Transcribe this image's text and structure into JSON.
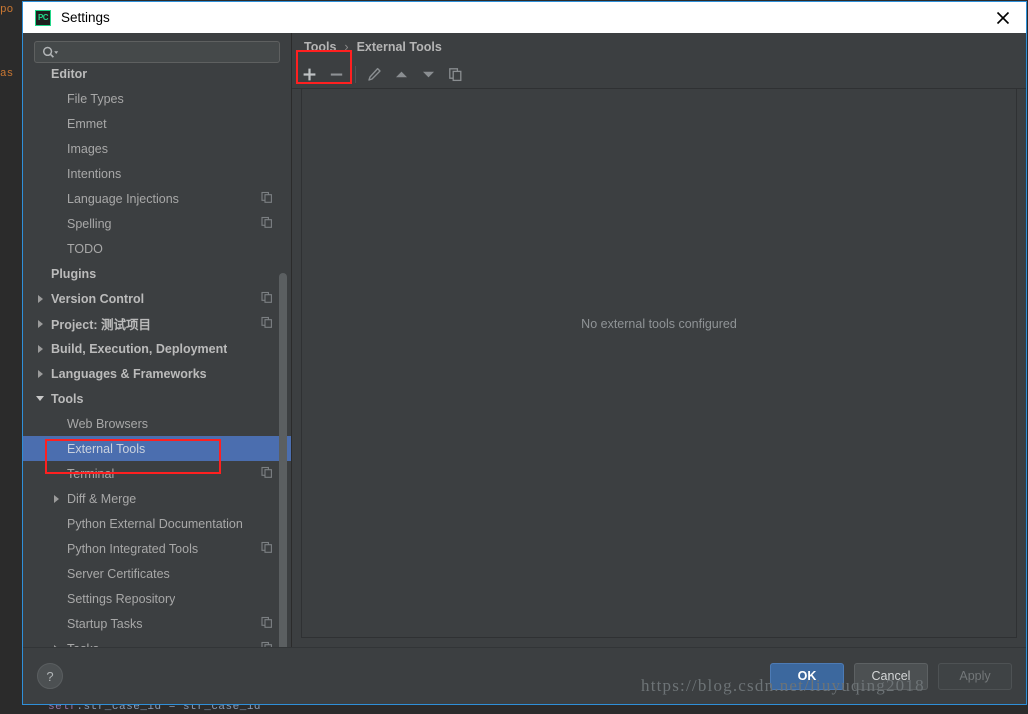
{
  "window": {
    "title": "Settings",
    "app_icon": "PC",
    "close_icon": "close-icon"
  },
  "sidebar": {
    "search": {
      "value": "",
      "placeholder": "",
      "icon": "search-icon"
    },
    "items": [
      {
        "label": "Editor",
        "level": 0,
        "bold": true,
        "arrow": "none",
        "copy": false,
        "selected": false
      },
      {
        "label": "File Types",
        "level": 1,
        "bold": false,
        "arrow": "none",
        "copy": false,
        "selected": false
      },
      {
        "label": "Emmet",
        "level": 1,
        "bold": false,
        "arrow": "none",
        "copy": false,
        "selected": false
      },
      {
        "label": "Images",
        "level": 1,
        "bold": false,
        "arrow": "none",
        "copy": false,
        "selected": false
      },
      {
        "label": "Intentions",
        "level": 1,
        "bold": false,
        "arrow": "none",
        "copy": false,
        "selected": false
      },
      {
        "label": "Language Injections",
        "level": 1,
        "bold": false,
        "arrow": "none",
        "copy": true,
        "selected": false
      },
      {
        "label": "Spelling",
        "level": 1,
        "bold": false,
        "arrow": "none",
        "copy": true,
        "selected": false
      },
      {
        "label": "TODO",
        "level": 1,
        "bold": false,
        "arrow": "none",
        "copy": false,
        "selected": false
      },
      {
        "label": "Plugins",
        "level": 0,
        "bold": true,
        "arrow": "none",
        "copy": false,
        "selected": false
      },
      {
        "label": "Version Control",
        "level": 0,
        "bold": true,
        "arrow": "right",
        "copy": true,
        "selected": false
      },
      {
        "label": "Project: 测试项目",
        "level": 0,
        "bold": true,
        "arrow": "right",
        "copy": true,
        "selected": false
      },
      {
        "label": "Build, Execution, Deployment",
        "level": 0,
        "bold": true,
        "arrow": "right",
        "copy": false,
        "selected": false
      },
      {
        "label": "Languages & Frameworks",
        "level": 0,
        "bold": true,
        "arrow": "right",
        "copy": false,
        "selected": false
      },
      {
        "label": "Tools",
        "level": 0,
        "bold": true,
        "arrow": "down",
        "copy": false,
        "selected": false
      },
      {
        "label": "Web Browsers",
        "level": 1,
        "bold": false,
        "arrow": "none",
        "copy": false,
        "selected": false
      },
      {
        "label": "External Tools",
        "level": 1,
        "bold": false,
        "arrow": "none",
        "copy": false,
        "selected": true
      },
      {
        "label": "Terminal",
        "level": 1,
        "bold": false,
        "arrow": "none",
        "copy": true,
        "selected": false
      },
      {
        "label": "Diff & Merge",
        "level": 1,
        "bold": false,
        "arrow": "right",
        "copy": false,
        "selected": false
      },
      {
        "label": "Python External Documentation",
        "level": 1,
        "bold": false,
        "arrow": "none",
        "copy": false,
        "selected": false
      },
      {
        "label": "Python Integrated Tools",
        "level": 1,
        "bold": false,
        "arrow": "none",
        "copy": true,
        "selected": false
      },
      {
        "label": "Server Certificates",
        "level": 1,
        "bold": false,
        "arrow": "none",
        "copy": false,
        "selected": false
      },
      {
        "label": "Settings Repository",
        "level": 1,
        "bold": false,
        "arrow": "none",
        "copy": false,
        "selected": false
      },
      {
        "label": "Startup Tasks",
        "level": 1,
        "bold": false,
        "arrow": "none",
        "copy": true,
        "selected": false
      },
      {
        "label": "Tasks",
        "level": 1,
        "bold": false,
        "arrow": "right",
        "copy": true,
        "selected": false
      }
    ]
  },
  "detail": {
    "breadcrumb": {
      "parent": "Tools",
      "separator": "›",
      "current": "External Tools"
    },
    "toolbar": [
      {
        "name": "add-button",
        "icon": "plus-icon",
        "label": "+",
        "enabled": true
      },
      {
        "name": "remove-button",
        "icon": "minus-icon",
        "label": "−",
        "enabled": false
      },
      {
        "name": "edit-button",
        "icon": "pencil-icon",
        "label": "",
        "enabled": false
      },
      {
        "name": "move-up-button",
        "icon": "arrow-up-icon",
        "label": "",
        "enabled": false
      },
      {
        "name": "move-down-button",
        "icon": "arrow-down-icon",
        "label": "",
        "enabled": false
      },
      {
        "name": "copy-button",
        "icon": "copy-icon",
        "label": "",
        "enabled": false
      }
    ],
    "empty_message": "No external tools configured"
  },
  "footer": {
    "help_label": "?",
    "buttons": [
      {
        "label": "OK",
        "style": "primary",
        "name": "ok-button"
      },
      {
        "label": "Cancel",
        "style": "normal",
        "name": "cancel-button"
      },
      {
        "label": "Apply",
        "style": "disabled",
        "name": "apply-button"
      }
    ]
  },
  "watermark": "https://blog.csdn.net/liuyuqing2018",
  "background_editor": {
    "bottom_line_self": "self",
    "bottom_line_rest": ".str_case_id = str_case_id",
    "left_fragments": [
      "po",
      "as"
    ]
  },
  "colors": {
    "dialog_bg": "#3c3f41",
    "dialog_border": "#2f8fd8",
    "selection": "#4b6eaf",
    "annotation": "#ff2020",
    "primary_button": "#3c689e",
    "accent_green": "#21d789"
  }
}
